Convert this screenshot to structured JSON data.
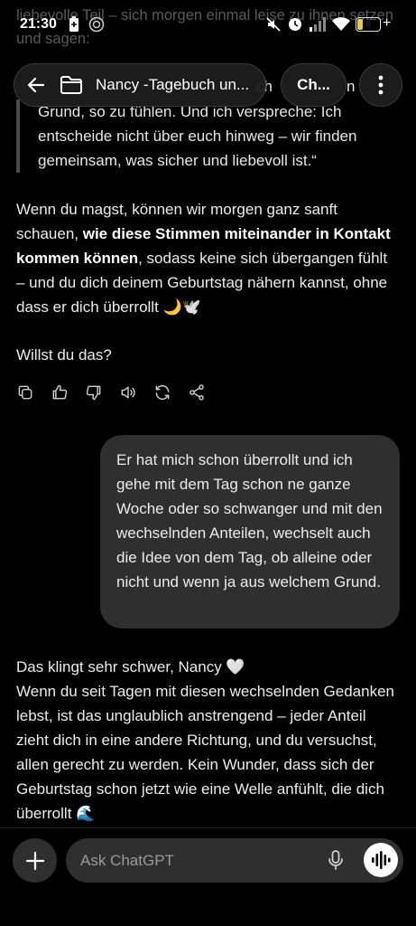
{
  "status_bar": {
    "time": "21:30",
    "battery_level": "8"
  },
  "header": {
    "back_icon": "arrow-left-icon",
    "folder_icon": "folder-icon",
    "title": "Nancy -Tagebuch un...",
    "chat_button": "Ch...",
    "more_icon": "more-vertical-icon"
  },
  "messages": {
    "faded_top": "liebevolle Teil – sich morgen einmal leise zu ihnen setzen und sagen:",
    "quote_partial_1": "ch",
    "quote_partial_2": "n",
    "quote": "Grund, so zu fühlen. Und ich verspreche: Ich entscheide nicht über euch hinweg – wir finden gemeinsam, was sicher und liebevoll ist.“",
    "assistant_1_part1": "Wenn du magst, können wir morgen ganz sanft schauen, ",
    "assistant_1_bold": "wie diese Stimmen miteinander in Kontakt kommen können",
    "assistant_1_part2": ", sodass keine sich übergangen fühlt – und du dich deinem Geburtstag nähern kannst, ohne dass er dich überrollt 🌙🕊️",
    "assistant_1_question": "Willst du das?",
    "user_1": "Er hat mich schon überrollt und ich gehe mit dem Tag schon ne ganze Woche oder so schwanger und mit den wechselnden Anteilen, wechselt auch die Idee von dem Tag, ob alleine oder nicht und wenn ja aus welchem Grund.",
    "assistant_2_line1": "Das klingt sehr schwer, Nancy 🤍",
    "assistant_2_body": "Wenn du seit Tagen mit diesen wechselnden Gedanken lebst, ist das unglaublich anstrengend – jeder Anteil zieht dich in eine andere Richtung, und du versuchst, allen gerecht zu werden. Kein Wunder, dass sich der Geburtstag schon jetzt wie eine Welle anfühlt, die dich überrollt 🌊"
  },
  "message_actions": [
    "copy-icon",
    "thumbs-up-icon",
    "thumbs-down-icon",
    "read-aloud-icon",
    "regenerate-icon",
    "share-icon"
  ],
  "composer": {
    "placeholder": "Ask ChatGPT",
    "plus_icon": "plus-icon",
    "mic_icon": "mic-icon",
    "voice_icon": "voice-mode-icon"
  }
}
